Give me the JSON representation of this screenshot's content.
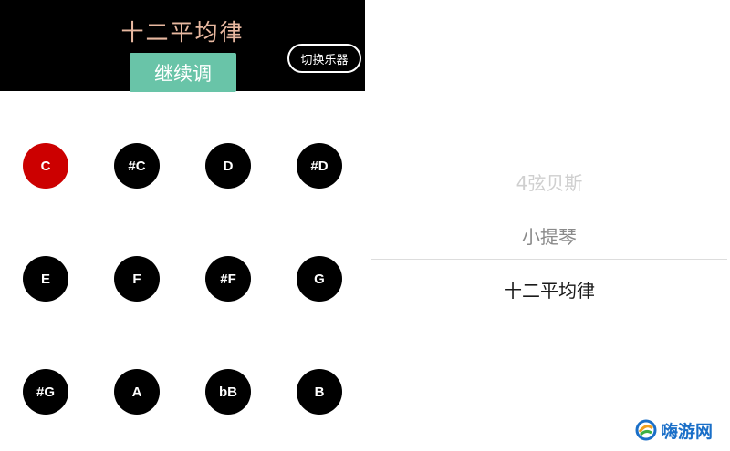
{
  "header": {
    "title": "十二平均律",
    "continue_label": "继续调",
    "switch_label": "切换乐器"
  },
  "notes": [
    "C",
    "#C",
    "D",
    "#D",
    "E",
    "F",
    "#F",
    "G",
    "#G",
    "A",
    "bB",
    "B"
  ],
  "active_note": "C",
  "picker": {
    "items": [
      "4弦贝斯",
      "小提琴",
      "十二平均律"
    ],
    "selected": "十二平均律"
  },
  "watermark": {
    "text": "嗨游网"
  },
  "colors": {
    "header_bg": "#000000",
    "title": "#e8b8a0",
    "accent_button": "#69c4a8",
    "note_default": "#000000",
    "note_active": "#cc0000"
  }
}
